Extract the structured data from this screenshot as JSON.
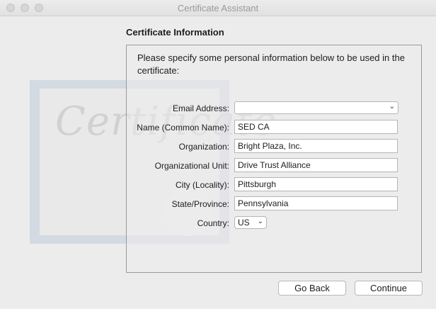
{
  "window": {
    "title": "Certificate Assistant"
  },
  "header": {
    "section_title": "Certificate Information"
  },
  "panel": {
    "instructions": "Please specify some personal information below to be used in the certificate:"
  },
  "form": {
    "email": {
      "label": "Email Address:",
      "value": ""
    },
    "common_name": {
      "label": "Name (Common Name):",
      "value": "SED CA"
    },
    "organization": {
      "label": "Organization:",
      "value": "Bright Plaza, Inc."
    },
    "org_unit": {
      "label": "Organizational Unit:",
      "value": "Drive Trust Alliance"
    },
    "city": {
      "label": "City (Locality):",
      "value": "Pittsburgh"
    },
    "state": {
      "label": "State/Province:",
      "value": "Pennsylvania"
    },
    "country": {
      "label": "Country:",
      "value": "US"
    }
  },
  "art": {
    "script_text": "Certificate"
  },
  "buttons": {
    "back": "Go Back",
    "continue": "Continue"
  },
  "icons": {
    "chevron": "chevron-down-icon"
  }
}
